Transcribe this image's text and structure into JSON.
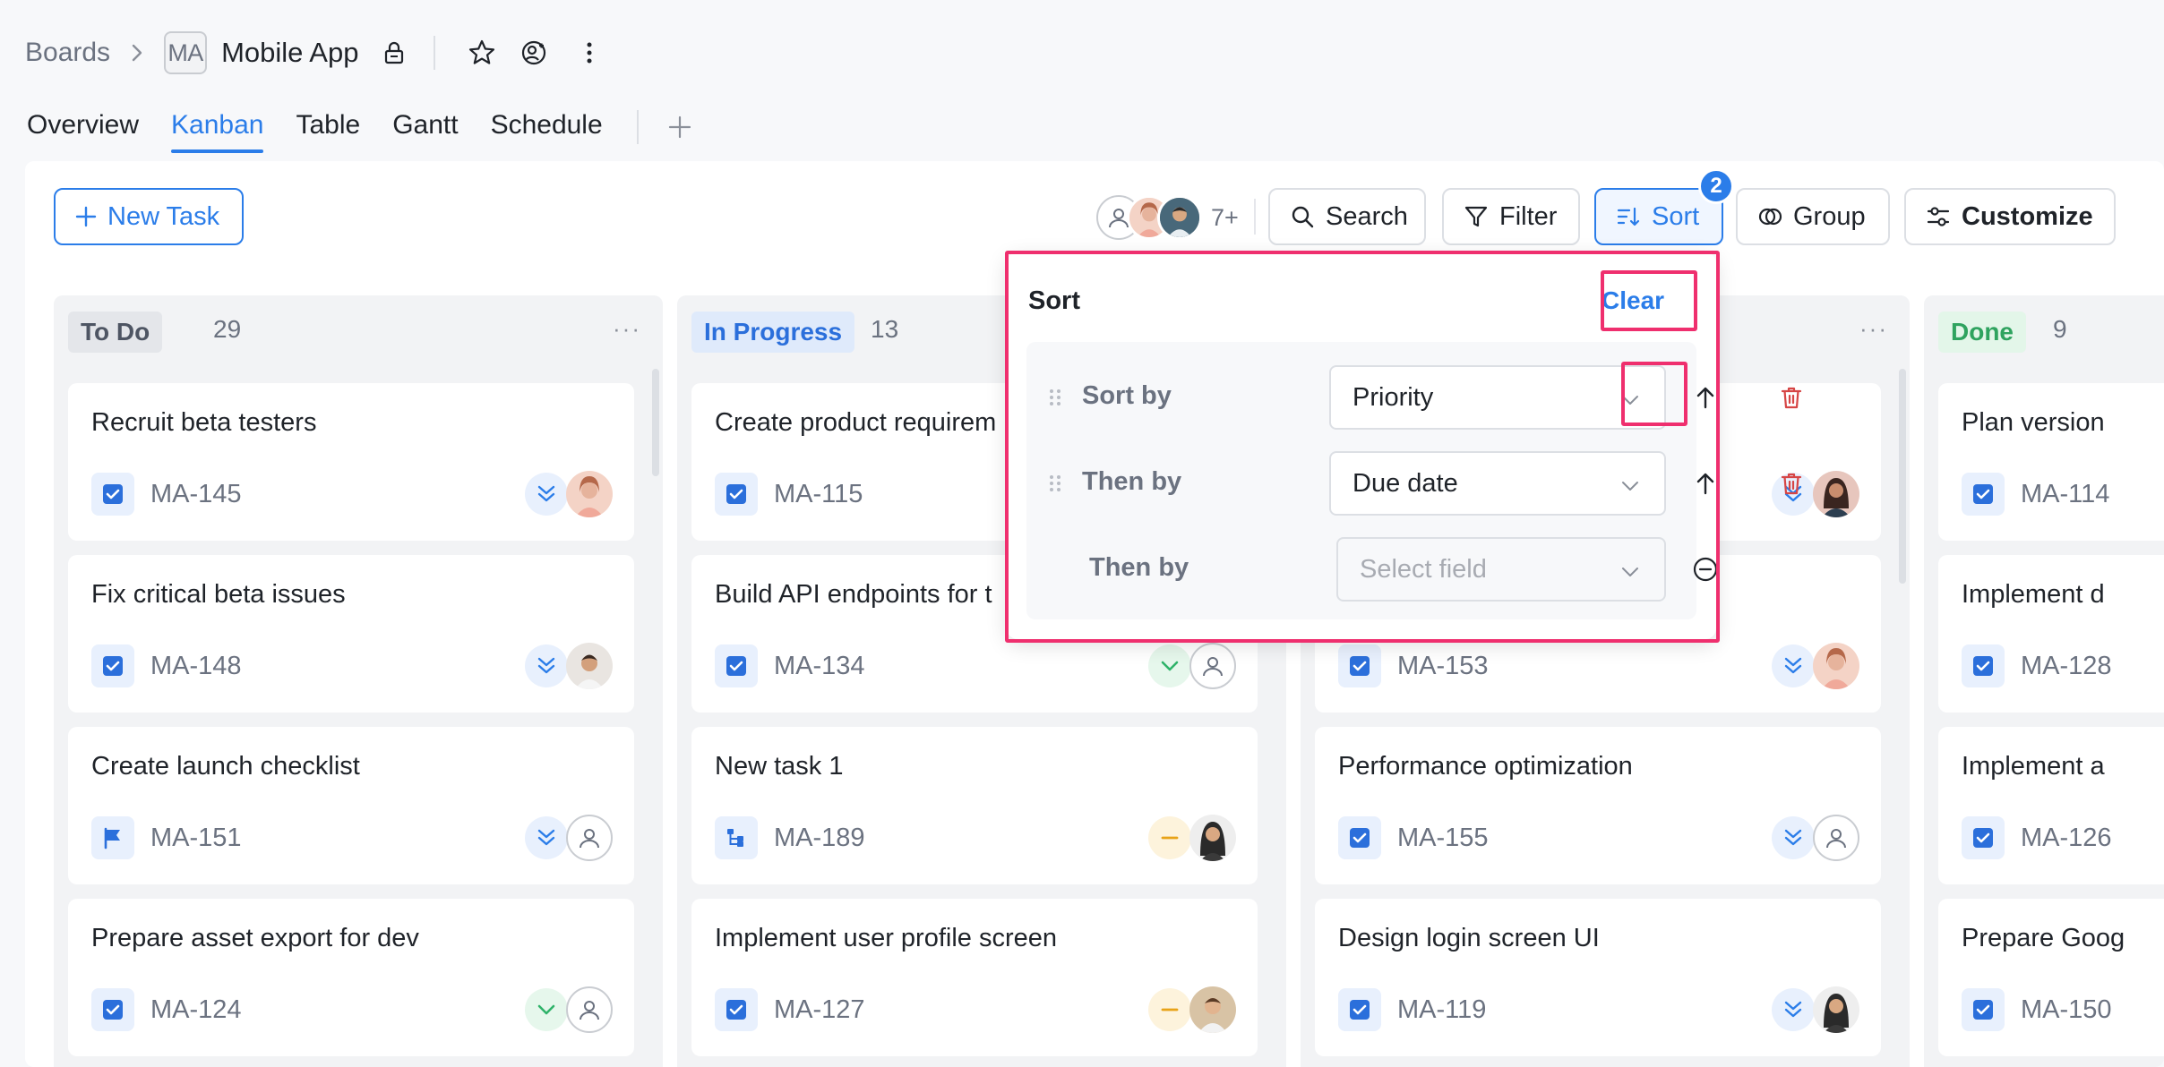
{
  "header": {
    "breadcrumb_root": "Boards",
    "project_initials": "MA",
    "project_name": "Mobile App"
  },
  "tabs": [
    {
      "label": "Overview",
      "active": false
    },
    {
      "label": "Kanban",
      "active": true
    },
    {
      "label": "Table",
      "active": false
    },
    {
      "label": "Gantt",
      "active": false
    },
    {
      "label": "Schedule",
      "active": false
    }
  ],
  "toolbar": {
    "new_task_label": "New Task",
    "members_more": "7+",
    "search_label": "Search",
    "filter_label": "Filter",
    "sort_label": "Sort",
    "sort_badge": "2",
    "group_label": "Group",
    "customize_label": "Customize"
  },
  "columns": [
    {
      "name": "To Do",
      "count": "29",
      "cards": [
        {
          "title": "Recruit beta testers",
          "key": "MA-145",
          "type": "task",
          "priority": "high",
          "assignee": "woman-1"
        },
        {
          "title": "Fix critical beta issues",
          "key": "MA-148",
          "type": "task",
          "priority": "high",
          "assignee": "man-1"
        },
        {
          "title": "Create launch checklist",
          "key": "MA-151",
          "type": "milestone",
          "priority": "high",
          "assignee": "none"
        },
        {
          "title": "Prepare asset export for dev",
          "key": "MA-124",
          "type": "task",
          "priority": "low",
          "assignee": "none"
        }
      ]
    },
    {
      "name": "In Progress",
      "count": "13",
      "cards": [
        {
          "title": "Create product requirem",
          "key": "MA-115",
          "type": "task",
          "priority": "",
          "assignee": ""
        },
        {
          "title": "Build API endpoints for t",
          "key": "MA-134",
          "type": "task",
          "priority": "low",
          "assignee": "none"
        },
        {
          "title": "New task 1",
          "key": "MA-189",
          "type": "subtask",
          "priority": "medium",
          "assignee": "woman-2"
        },
        {
          "title": "Implement user profile screen",
          "key": "MA-127",
          "type": "task",
          "priority": "medium",
          "assignee": "man-2"
        }
      ]
    },
    {
      "name": "",
      "count": "",
      "cards": [
        {
          "title": "",
          "key": "",
          "type": "",
          "priority": "high",
          "assignee": "woman-3"
        },
        {
          "title": "",
          "key": "MA-153",
          "type": "task",
          "priority": "high",
          "assignee": "woman-1"
        },
        {
          "title": "Performance optimization",
          "key": "MA-155",
          "type": "task",
          "priority": "high",
          "assignee": "none"
        },
        {
          "title": "Design login screen UI",
          "key": "MA-119",
          "type": "task",
          "priority": "high",
          "assignee": "woman-2"
        }
      ]
    },
    {
      "name": "Done",
      "count": "9",
      "cards": [
        {
          "title": "Plan version",
          "key": "MA-114",
          "type": "task"
        },
        {
          "title": "Implement d",
          "key": "MA-128",
          "type": "task"
        },
        {
          "title": "Implement a",
          "key": "MA-126",
          "type": "task"
        },
        {
          "title": "Prepare Goog",
          "key": "MA-150",
          "type": "task"
        }
      ]
    }
  ],
  "sort_popover": {
    "title": "Sort",
    "clear_label": "Clear",
    "rows": [
      {
        "label": "Sort by",
        "field": "Priority"
      },
      {
        "label": "Then by",
        "field": "Due date"
      },
      {
        "label": "Then by",
        "placeholder": "Select field"
      }
    ]
  },
  "colors": {
    "accent": "#2b7de9",
    "highlight": "#ef2f6e",
    "danger": "#d64545",
    "todo_tag_bg": "#e4e6ea",
    "inprogress_tag_bg": "#dfeafb",
    "done_tag_bg": "#e3f6e9"
  }
}
